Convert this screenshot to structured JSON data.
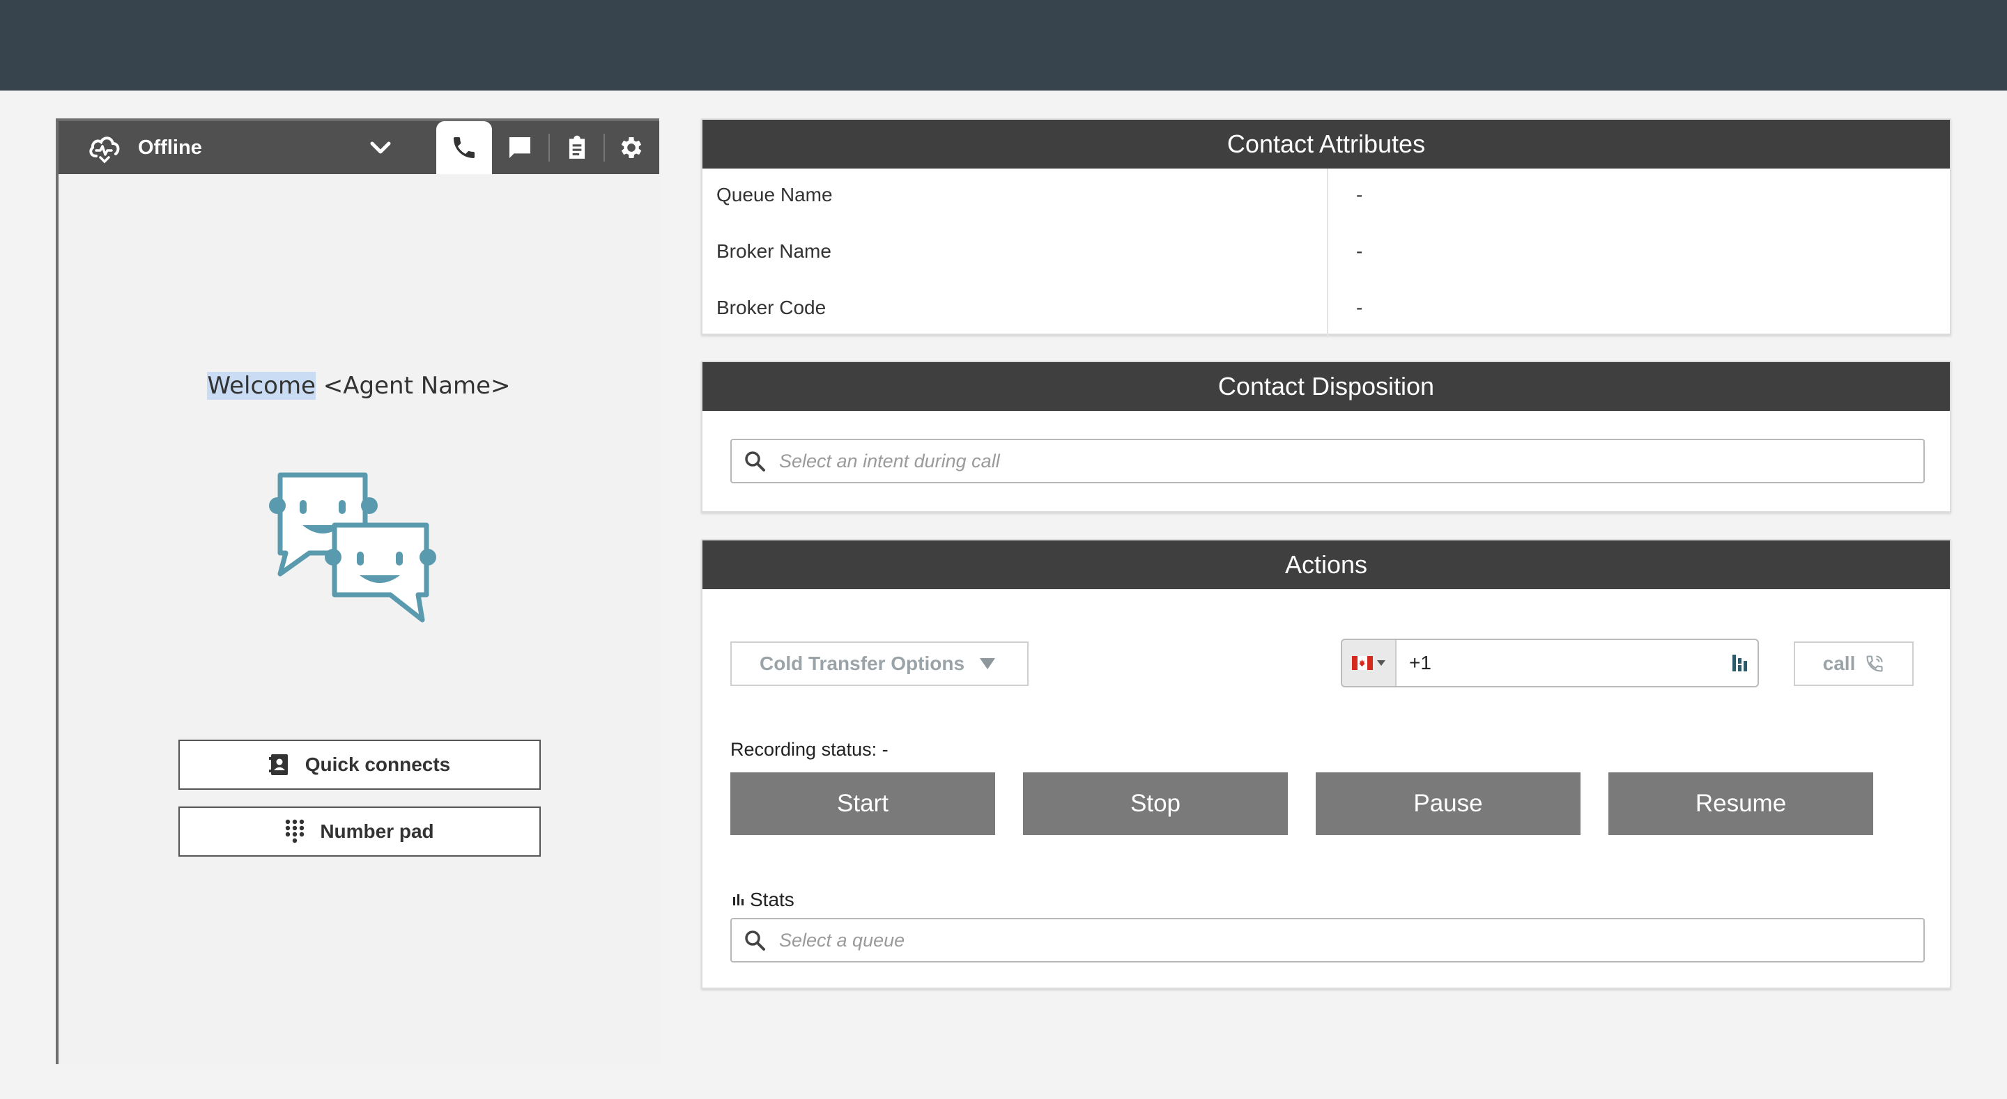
{
  "ccp": {
    "status": "Offline",
    "tabs": [
      "phone-icon",
      "chat-icon",
      "clipboard-icon",
      "gear-icon"
    ],
    "welcome_word": "Welcome",
    "welcome_name": " <Agent Name>",
    "quick_connects_label": "Quick connects",
    "number_pad_label": "Number pad"
  },
  "contact_attributes": {
    "title": "Contact Attributes",
    "rows": [
      {
        "name": "Queue Name",
        "value": "-"
      },
      {
        "name": "Broker Name",
        "value": "-"
      },
      {
        "name": "Broker Code",
        "value": "-"
      }
    ]
  },
  "contact_disposition": {
    "title": "Contact Disposition",
    "intent_placeholder": "Select an intent during call"
  },
  "actions": {
    "title": "Actions",
    "cold_transfer_label": "Cold Transfer Options",
    "phone_value": "+1",
    "call_label": "call",
    "recording_status": "Recording status: -",
    "buttons": [
      "Start",
      "Stop",
      "Pause",
      "Resume"
    ],
    "stats_label": "Stats",
    "queue_placeholder": "Select a queue"
  },
  "colors": {
    "topbar": "#37444e",
    "panel_header": "#3f3f3f",
    "ccp_header": "#505050",
    "recording_button": "#7a7a7a",
    "bubble_accent": "#5a9aae"
  }
}
